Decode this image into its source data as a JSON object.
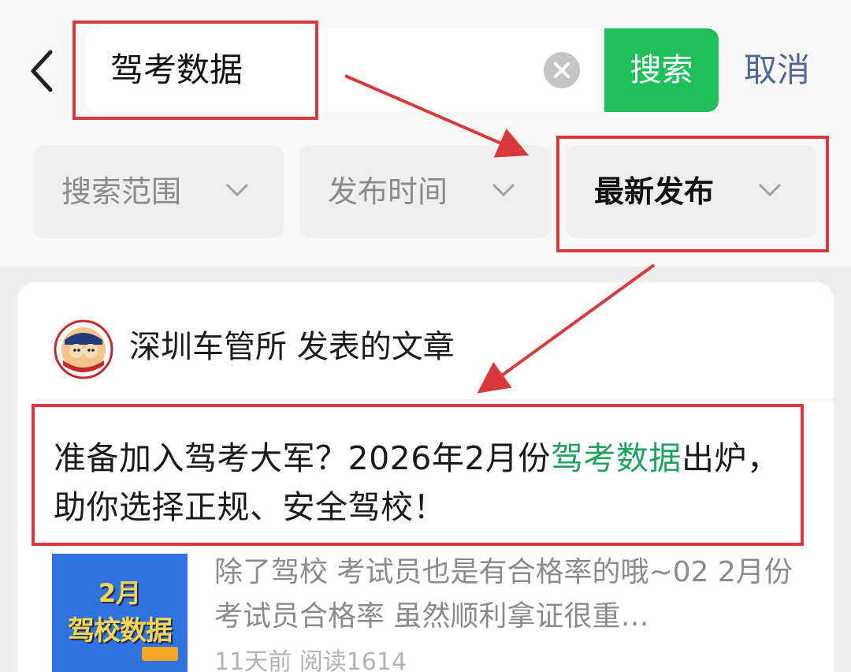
{
  "search": {
    "query": "驾考数据",
    "search_label": "搜索",
    "cancel_label": "取消"
  },
  "filters": [
    {
      "label": "搜索范围",
      "active": false
    },
    {
      "label": "发布时间",
      "active": false
    },
    {
      "label": "最新发布",
      "active": true
    }
  ],
  "result": {
    "author_line": "深圳车管所 发表的文章",
    "title_before": "准备加入驾考大军？2026年2月份",
    "title_highlight": "驾考数据",
    "title_after": "出炉，助你选择正规、安全驾校！",
    "thumbnail": {
      "line1": "2月",
      "line2": "驾校数据"
    },
    "snippet": "除了驾校 考试员也是有合格率的哦~02 2月份 考试员合格率 虽然顺利拿证很重…",
    "meta": "11天前  阅读1614"
  },
  "colors": {
    "search_button": "#1fbf5c",
    "highlight": "#1fa35c",
    "cancel": "#53678f",
    "annotation": "#d9393a",
    "thumbnail_bg": "#2f73df"
  },
  "icons": [
    "back-arrow-icon",
    "clear-icon",
    "chevron-down-icon",
    "avatar"
  ]
}
